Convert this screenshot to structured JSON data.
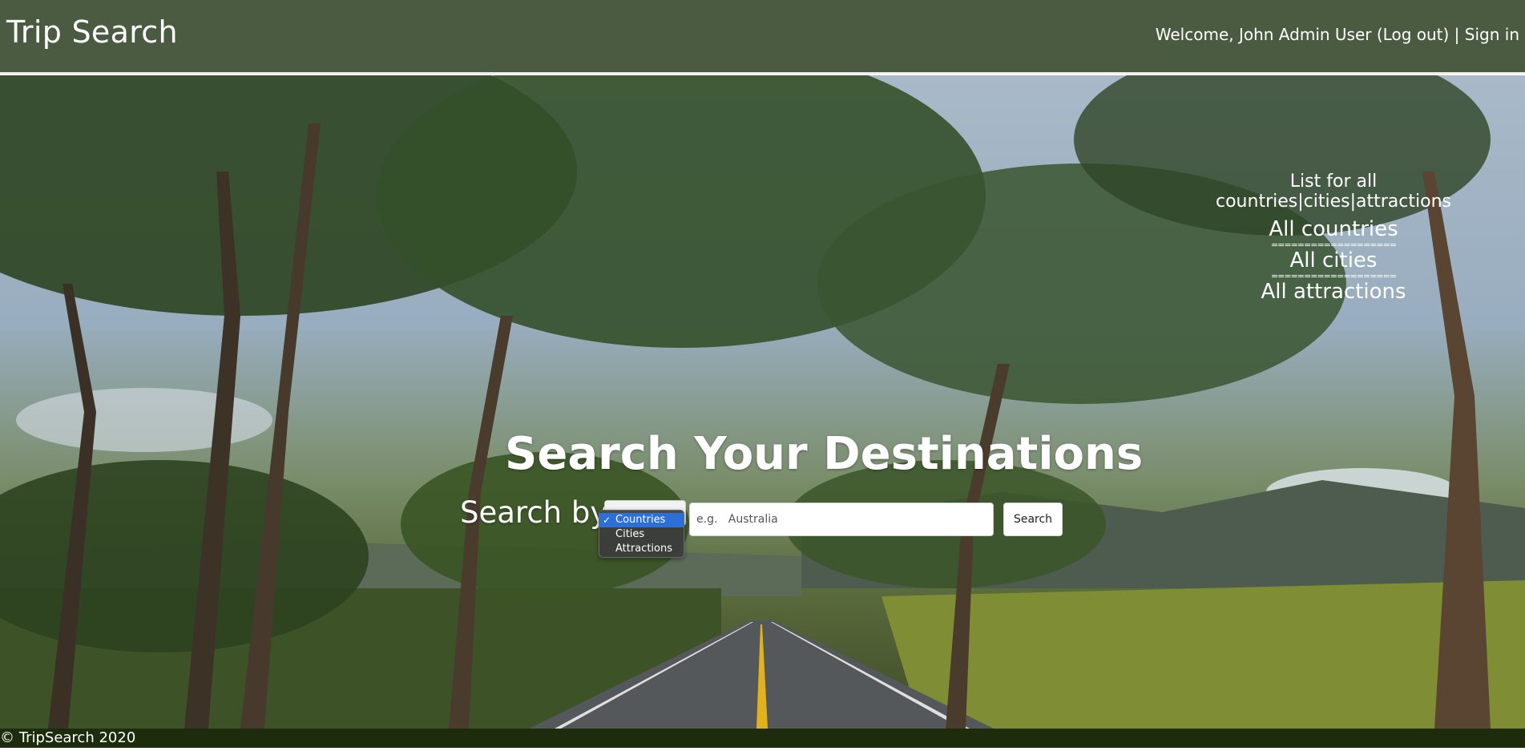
{
  "navbar": {
    "brand": "Trip Search",
    "welcome_text": "Welcome, John Admin User",
    "logout": "(Log out)",
    "divider": "|",
    "signin": "Sign in"
  },
  "lists": {
    "prefix": "List for all ",
    "countries_link": "countries",
    "cities_link": "cities",
    "attractions_link": "attractions",
    "pipe": "|",
    "all_countries": "All countries",
    "all_cities": "All cities",
    "all_attractions": "All attractions",
    "separator": "==================="
  },
  "hero": {
    "title": "Search Your Destinations",
    "search_label": "Search by:"
  },
  "search": {
    "options": [
      "Countries",
      "Cities",
      "Attractions"
    ],
    "selected_option": "Countries",
    "check": "✓",
    "placeholder": "e.g.   Australia",
    "button": "Search"
  },
  "footer": {
    "text": "© TripSearch 2020"
  },
  "colors": {
    "navbar": "#4b5b42",
    "footer": "#1d2c0c",
    "selection": "#2c6fd6"
  }
}
